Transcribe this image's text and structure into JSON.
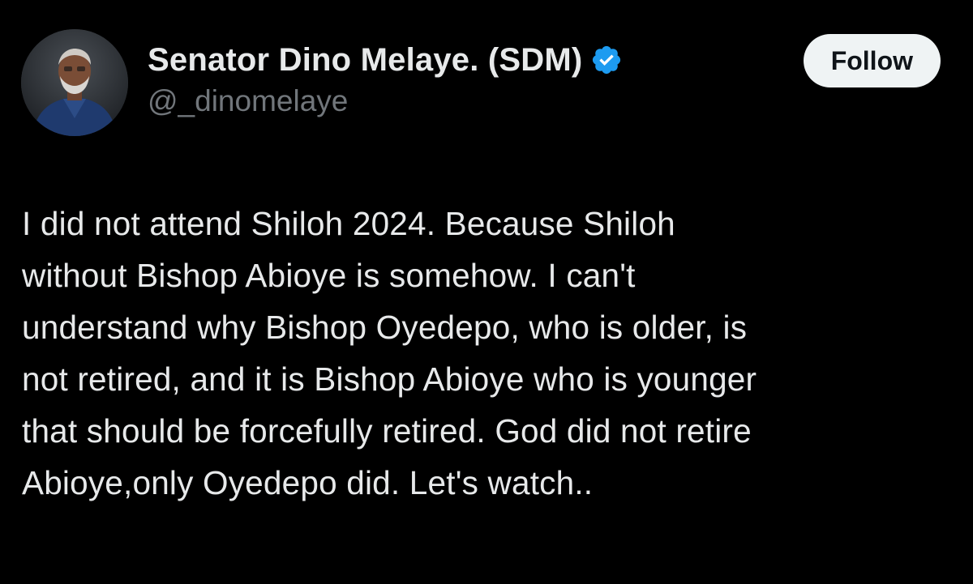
{
  "author": {
    "display_name": "Senator Dino Melaye. (SDM)",
    "handle": "@_dinomelaye",
    "verified": true,
    "verified_icon": "verified-badge-icon",
    "avatar": "profile-photo"
  },
  "actions": {
    "follow_label": "Follow"
  },
  "tweet": {
    "text": "I did not attend Shiloh 2024. Because Shiloh\nwithout Bishop Abioye is somehow. I can't\nunderstand why Bishop Oyedepo, who is older, is\nnot retired, and it is Bishop Abioye who is younger\nthat should be forcefully retired. God did not retire\nAbioye,only Oyedepo did.  Let's watch.."
  },
  "colors": {
    "background": "#000000",
    "primary_text": "#e7e9ea",
    "secondary_text": "#71767b",
    "verified_blue": "#1d9bf0",
    "button_bg": "#eff3f4",
    "button_text": "#0f1419"
  }
}
